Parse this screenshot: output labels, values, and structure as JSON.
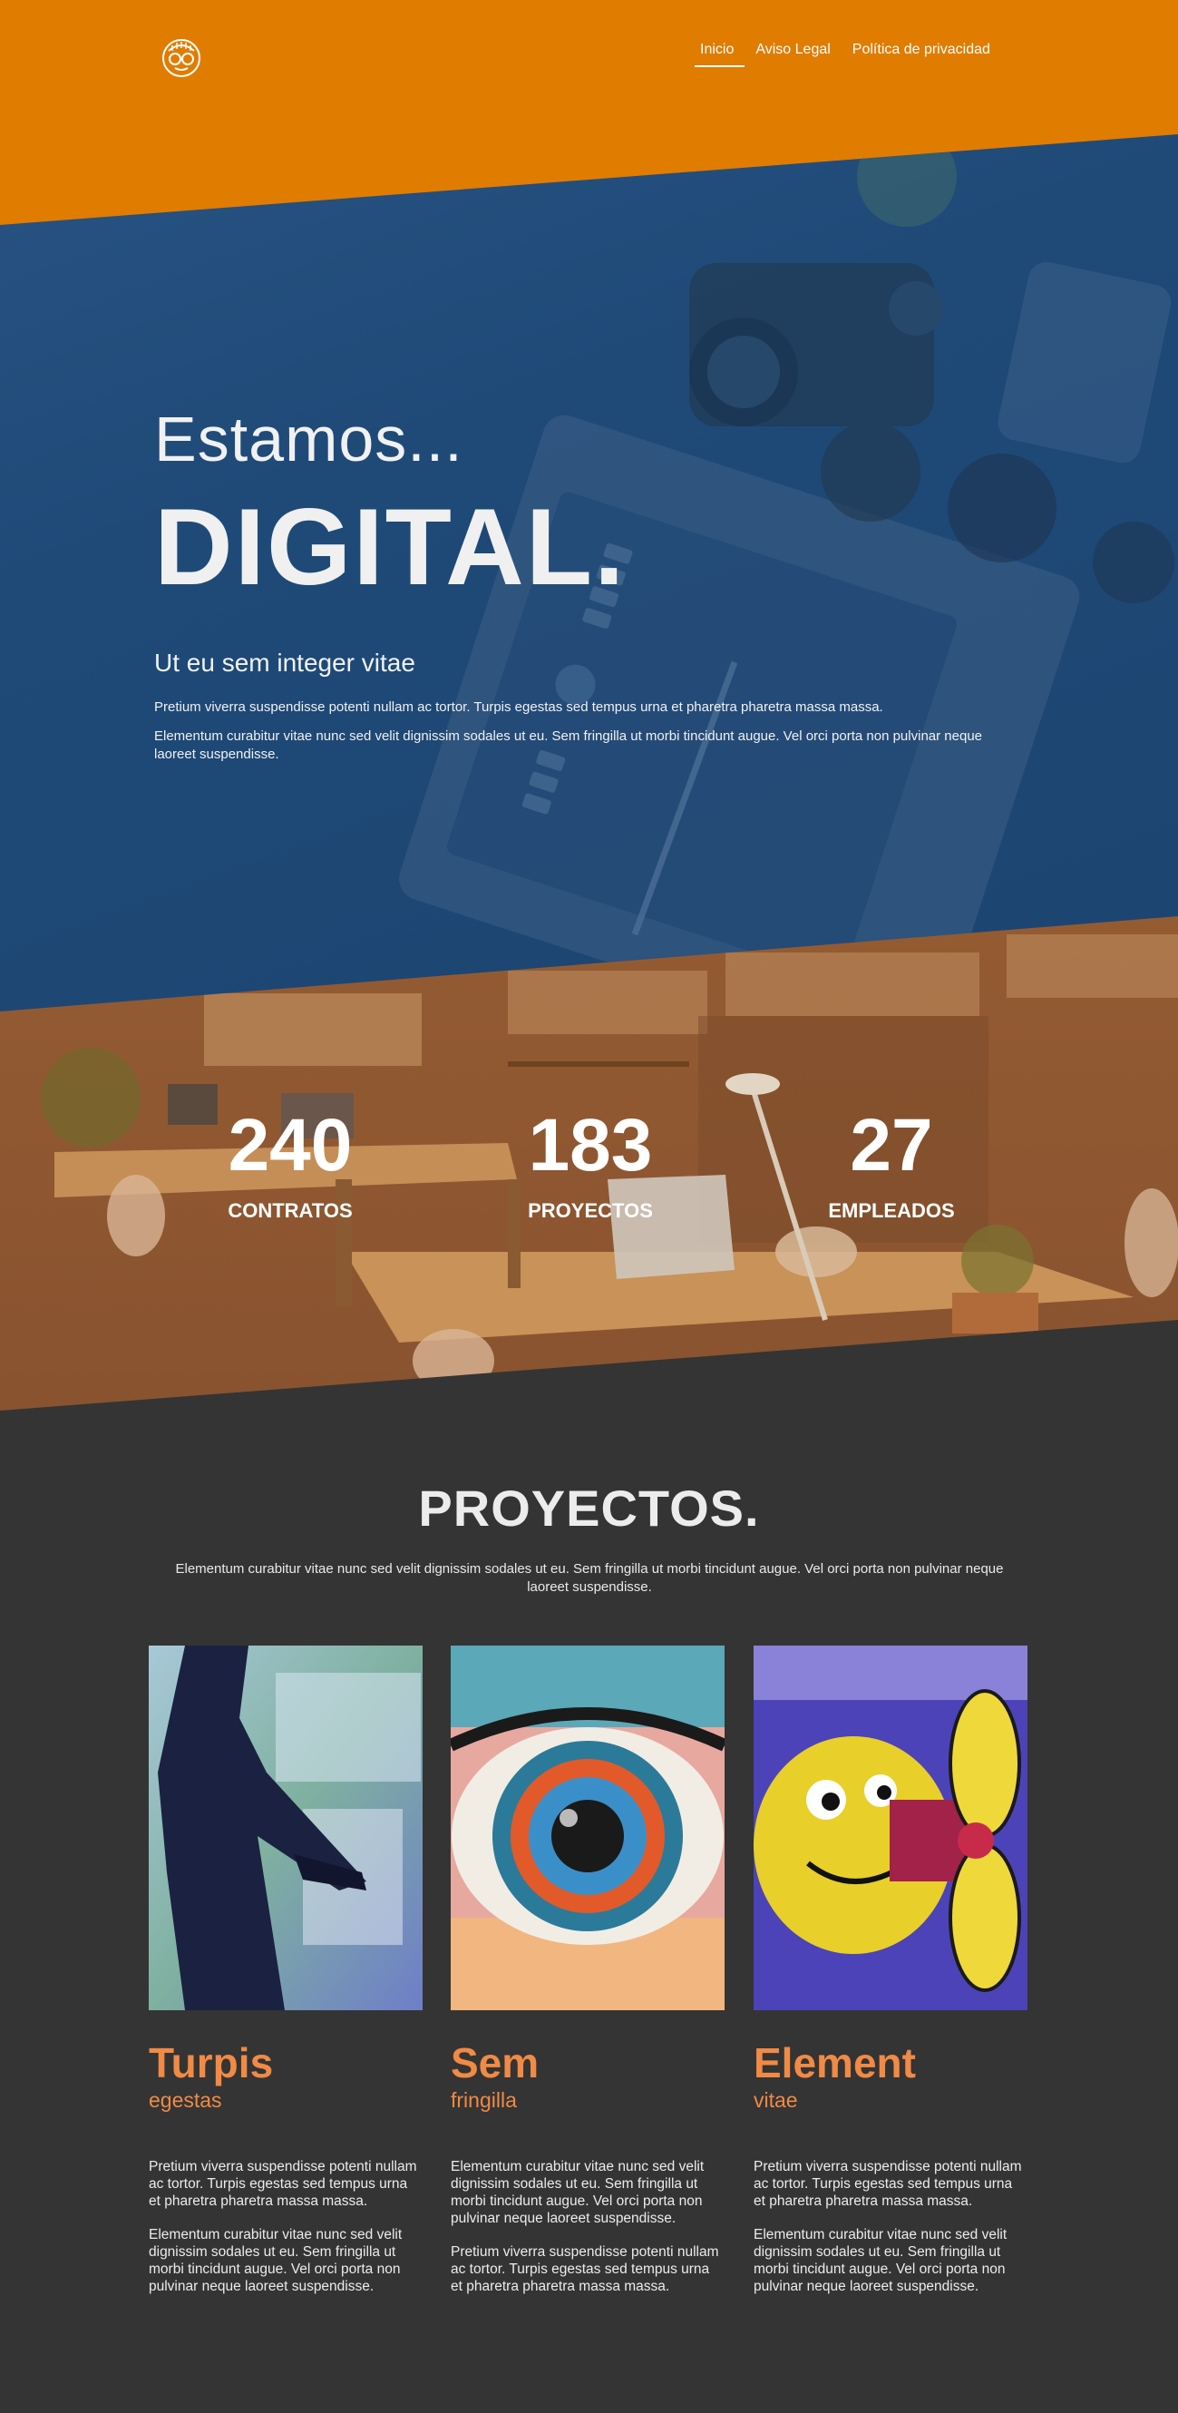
{
  "nav": {
    "items": [
      {
        "label": "Inicio",
        "active": true
      },
      {
        "label": "Aviso Legal",
        "active": false
      },
      {
        "label": "Política de privacidad",
        "active": false
      }
    ]
  },
  "hero": {
    "pre_title": "Estamos...",
    "title": "DIGITAL.",
    "subtitle": "Ut eu sem integer vitae",
    "paragraph_1": "Pretium viverra suspendisse potenti nullam ac tortor. Turpis egestas sed tempus urna et pharetra pharetra massa massa.",
    "paragraph_2": "Elementum curabitur vitae nunc sed velit dignissim sodales ut eu. Sem fringilla ut morbi tincidunt augue. Vel orci porta non pulvinar neque laoreet suspendisse."
  },
  "stats": [
    {
      "value": "240",
      "label": "CONTRATOS"
    },
    {
      "value": "183",
      "label": "PROYECTOS"
    },
    {
      "value": "27",
      "label": "EMPLEADOS"
    }
  ],
  "projects": {
    "title": "PROYECTOS.",
    "intro": "Elementum curabitur vitae nunc sed velit dignissim sodales ut eu. Sem fringilla ut morbi tincidunt augue. Vel orci porta non pulvinar neque laoreet suspendisse.",
    "cards": [
      {
        "title": "Turpis",
        "subtitle": "egestas",
        "text_1": "Pretium viverra suspendisse potenti nullam ac tortor. Turpis egestas sed tempus urna et pharetra pharetra massa massa.",
        "text_2": "Elementum curabitur vitae nunc sed velit dignissim sodales ut eu. Sem fringilla ut morbi tincidunt augue. Vel orci porta non pulvinar neque laoreet suspendisse."
      },
      {
        "title": "Sem",
        "subtitle": "fringilla",
        "text_1": "Elementum curabitur vitae nunc sed velit dignissim sodales ut eu. Sem fringilla ut morbi tincidunt augue. Vel orci porta non pulvinar neque laoreet suspendisse.",
        "text_2": "Pretium viverra suspendisse potenti nullam ac tortor. Turpis egestas sed tempus urna et pharetra pharetra massa massa."
      },
      {
        "title": "Element",
        "subtitle": "vitae",
        "text_1": "Pretium viverra suspendisse potenti nullam ac tortor. Turpis egestas sed tempus urna et pharetra pharetra massa massa.",
        "text_2": "Elementum curabitur vitae nunc sed velit dignissim sodales ut eu. Sem fringilla ut morbi tincidunt augue. Vel orci porta non pulvinar neque laoreet suspendisse."
      }
    ]
  },
  "colors": {
    "header_orange": "#e07c00",
    "hero_blue": "#1f4a78",
    "stats_orange": "#9a6033",
    "page_dark": "#343434",
    "accent_orange": "#f08a45"
  }
}
